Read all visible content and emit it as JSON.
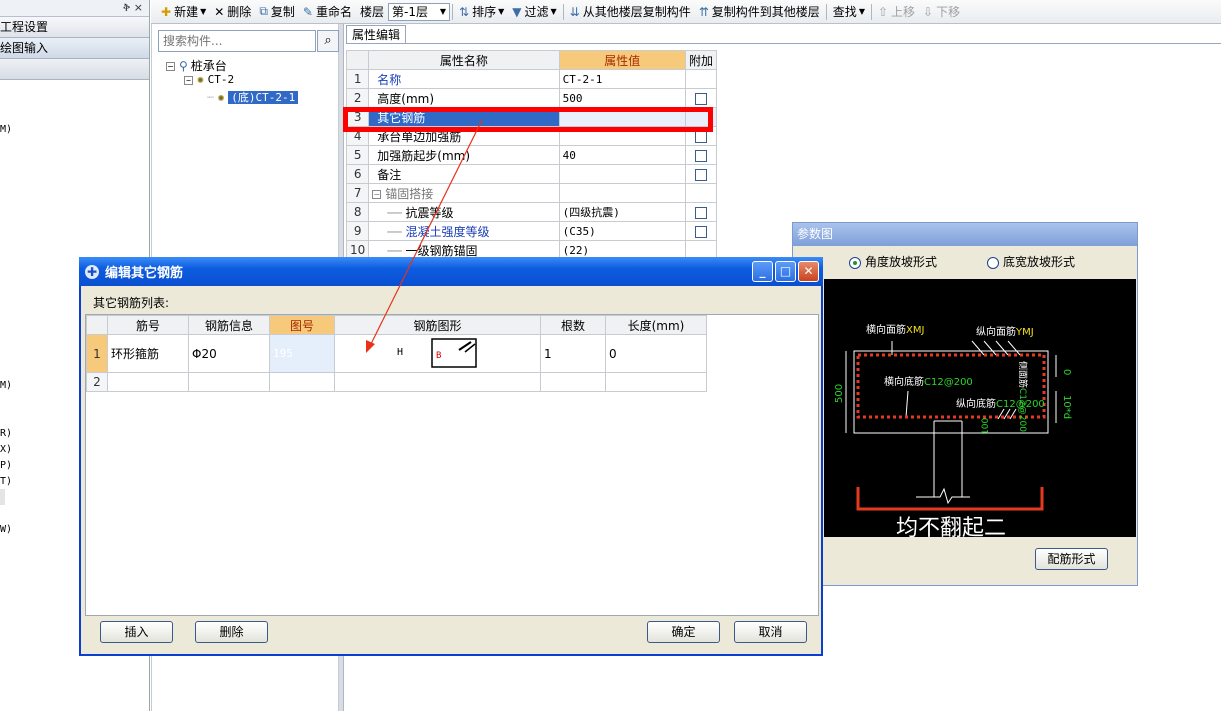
{
  "left_nav": {
    "pin_glyph": "ቅ ×",
    "items": [
      "工程设置",
      "绘图输入"
    ],
    "scrap_texts": [
      "M)",
      "M)",
      "R)",
      "X)",
      "P)",
      "T)",
      "W)"
    ]
  },
  "toolbar": {
    "new": "新建",
    "delete": "删除",
    "copy": "复制",
    "rename": "重命名",
    "floor_label": "楼层",
    "floor_value": "第-1层",
    "sort": "排序",
    "filter": "过滤",
    "copy_from_other": "从其他楼层复制构件",
    "copy_to_other": "复制构件到其他楼层",
    "find": "查找",
    "move_up": "上移",
    "move_down": "下移"
  },
  "tree": {
    "search_placeholder": "搜索构件...",
    "root": "桩承台",
    "child": "CT-2",
    "leaf": "(底)CT-2-1"
  },
  "property_panel": {
    "tab": "属性编辑",
    "headers": [
      "属性名称",
      "属性值",
      "附加"
    ],
    "rows": [
      {
        "num": "1",
        "name": "名称",
        "value": "CT-2-1"
      },
      {
        "num": "2",
        "name": "高度(mm)",
        "value": "500"
      },
      {
        "num": "3",
        "name": "其它钢筋",
        "value": ""
      },
      {
        "num": "4",
        "name": "承台单边加强筋",
        "value": ""
      },
      {
        "num": "5",
        "name": "加强筋起步(mm)",
        "value": "40"
      },
      {
        "num": "6",
        "name": "备注",
        "value": ""
      },
      {
        "num": "7",
        "name": "锚固搭接",
        "value": ""
      },
      {
        "num": "8",
        "name": "抗震等级",
        "value": "(四级抗震)"
      },
      {
        "num": "9",
        "name": "混凝土强度等级",
        "value": "(C35)"
      },
      {
        "num": "10",
        "name": "一级钢筋锚固",
        "value": "(22)"
      }
    ]
  },
  "dialog": {
    "title": "编辑其它钢筋",
    "list_label": "其它钢筋列表:",
    "headers": [
      "筋号",
      "钢筋信息",
      "图号",
      "钢筋图形",
      "根数",
      "长度(mm)"
    ],
    "rows": [
      {
        "num": "1",
        "bar_no": "环形箍筋",
        "info": "Φ20",
        "fig": "195",
        "shape_h": "H",
        "shape_b": "B",
        "count": "1",
        "length": "0"
      },
      {
        "num": "2",
        "bar_no": "",
        "info": "",
        "fig": "",
        "shape_h": "",
        "shape_b": "",
        "count": "",
        "length": ""
      }
    ],
    "buttons": {
      "insert": "插入",
      "delete": "删除",
      "ok": "确定",
      "cancel": "取消"
    }
  },
  "param_window": {
    "title": "参数图",
    "radio_angle": "角度放坡形式",
    "radio_width": "底宽放坡形式",
    "button": "配筋形式",
    "labels": {
      "top_horizontal": "横向面筋",
      "top_horizontal_code": "XMJ",
      "top_vertical": "纵向面筋",
      "top_vertical_code": "YMJ",
      "bottom_horizontal": "横向底筋",
      "bottom_horizontal_code": "C12@200",
      "bottom_vertical": "纵向底筋",
      "bottom_vertical_code": "C12@200",
      "side_bar": "侧面筋",
      "side_code": "C12@200",
      "height": "500",
      "dim_top": "0",
      "dim_right": "10*d",
      "dim_left_small": "100",
      "caption": "均不翻起二"
    },
    "colors": {
      "green": "#2bd62b",
      "red": "#e53a1e",
      "yellow": "#f4e21a"
    }
  }
}
